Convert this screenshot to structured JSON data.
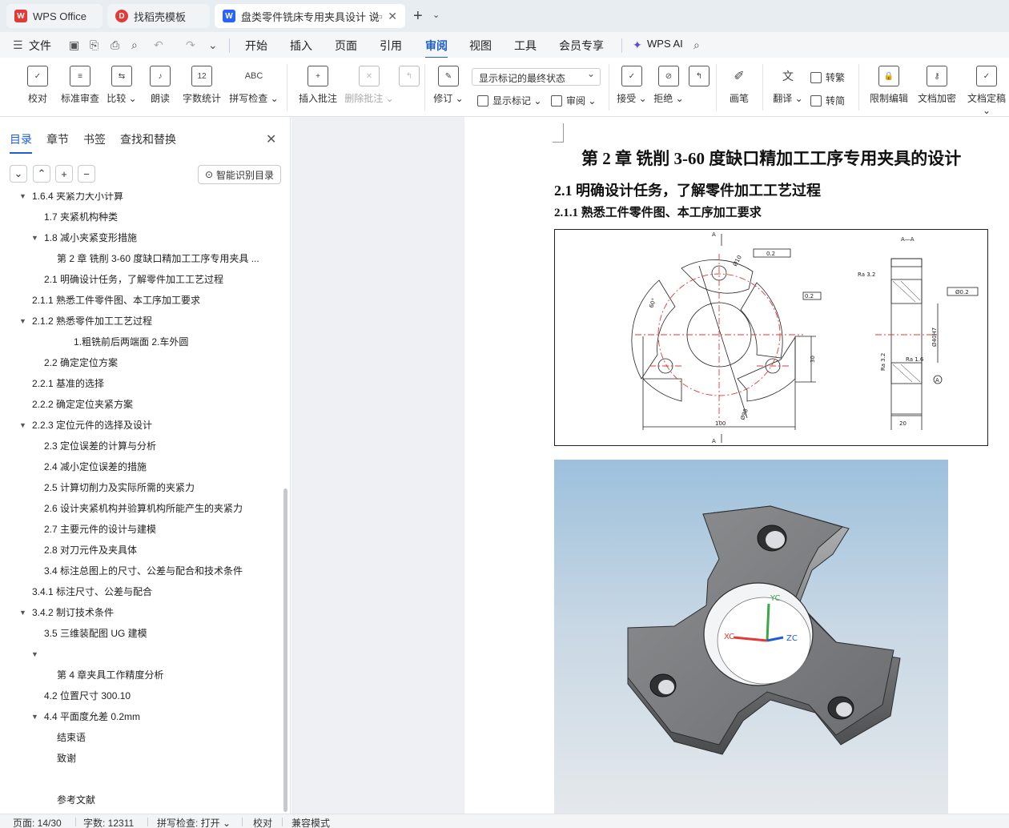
{
  "tabs": {
    "wps_office": "WPS Office",
    "template": "找稻壳模板",
    "document": "盘类零件铣床专用夹具设计 说"
  },
  "menu": {
    "file": "文件",
    "items": [
      "开始",
      "插入",
      "页面",
      "引用",
      "审阅",
      "视图",
      "工具",
      "会员专享"
    ],
    "active": "审阅",
    "wps_ai": "WPS AI"
  },
  "ribbon": {
    "proofread": "校对",
    "std_review": "标准审查",
    "compare": "比较",
    "read_aloud": "朗读",
    "word_count": "字数统计",
    "spell_check": "拼写检查",
    "insert_comment": "插入批注",
    "delete_comment": "删除批注",
    "track_changes": "修订",
    "markup_select": "显示标记的最终状态",
    "show_markup": "显示标记",
    "review": "审阅",
    "accept": "接受",
    "reject": "拒绝",
    "pen": "画笔",
    "translate": "翻译",
    "to_traditional": "转繁",
    "to_simplified": "转简",
    "restrict_edit": "限制编辑",
    "encrypt": "文档加密",
    "finalize": "文档定稿",
    "icon_word_count": "12",
    "icon_spell": "ABC"
  },
  "panel": {
    "tabs": [
      "目录",
      "章节",
      "书签",
      "查找和替换"
    ],
    "active_tab": "目录",
    "smart_toc": "智能识别目录",
    "toc": [
      {
        "text": "1.6.4  夹紧力大小计算",
        "indent": 1,
        "arrow": true
      },
      {
        "text": "1.7  夹紧机构种类",
        "indent": 2,
        "arrow": false
      },
      {
        "text": "1.8  减小夹紧变形措施",
        "indent": 2,
        "arrow": true
      },
      {
        "text": "第 2 章    铣削 3-60 度缺口精加工工序专用夹具 ...",
        "indent": 3,
        "arrow": false
      },
      {
        "text": "2.1  明确设计任务，了解零件加工工艺过程",
        "indent": 2,
        "arrow": false
      },
      {
        "text": "2.1.1  熟悉工件零件图、本工序加工要求",
        "indent": 1,
        "arrow": false
      },
      {
        "text": "2.1.2  熟悉零件加工工艺过程",
        "indent": 1,
        "arrow": true
      },
      {
        "text": "1.粗铣前后两端面            2.车外圆",
        "indent": 5,
        "arrow": false
      },
      {
        "text": "2.2  确定定位方案",
        "indent": 2,
        "arrow": false
      },
      {
        "text": "2.2.1  基准的选择",
        "indent": 1,
        "arrow": false
      },
      {
        "text": "2.2.2    确定定位夹紧方案",
        "indent": 1,
        "arrow": false
      },
      {
        "text": "2.2.3  定位元件的选择及设计",
        "indent": 1,
        "arrow": true
      },
      {
        "text": "2.3  定位误差的计算与分析",
        "indent": 2,
        "arrow": false
      },
      {
        "text": "2.4  减小定位误差的措施",
        "indent": 2,
        "arrow": false
      },
      {
        "text": "2.5  计算切削力及实际所需的夹紧力",
        "indent": 2,
        "arrow": false
      },
      {
        "text": "2.6  设计夹紧机构并验算机构所能产生的夹紧力",
        "indent": 2,
        "arrow": false
      },
      {
        "text": "2.7  主要元件的设计与建模",
        "indent": 2,
        "arrow": false
      },
      {
        "text": "2.8  对刀元件及夹具体",
        "indent": 2,
        "arrow": false
      },
      {
        "text": "3.4  标注总图上的尺寸、公差与配合和技术条件",
        "indent": 2,
        "arrow": false
      },
      {
        "text": "3.4.1  标注尺寸、公差与配合",
        "indent": 1,
        "arrow": false
      },
      {
        "text": "3.4.2 制订技术条件",
        "indent": 1,
        "arrow": true
      },
      {
        "text": "3.5  三维装配图 UG 建模",
        "indent": 2,
        "arrow": false
      },
      {
        "text": "",
        "indent": 2,
        "arrow": true
      },
      {
        "text": "第 4 章夹具工作精度分析",
        "indent": 3,
        "arrow": false
      },
      {
        "text": "4.2  位置尺寸 300.10",
        "indent": 2,
        "arrow": false
      },
      {
        "text": "4.4 平面度允差 0.2mm",
        "indent": 2,
        "arrow": true
      },
      {
        "text": "结束语",
        "indent": 3,
        "arrow": false
      },
      {
        "text": "致谢",
        "indent": 3,
        "arrow": false
      },
      {
        "text": "",
        "indent": 3,
        "arrow": false
      },
      {
        "text": "参考文献",
        "indent": 3,
        "arrow": false
      }
    ]
  },
  "document": {
    "chapter_title": "第 2 章    铣削 3-60 度缺口精加工工序专用夹具的设计",
    "heading_2_1": "2.1  明确设计任务，了解零件加工工艺过程",
    "heading_2_1_1": "2.1.1  熟悉工件零件图、本工序加工要求",
    "drawing_labels": {
      "section": "A—A",
      "a_top": "A",
      "a_bottom": "A",
      "tol1": "0.2",
      "tol2": "0.2",
      "tol3": "Ø0.2",
      "ra32_top": "Ra 3.2",
      "ra32_left": "Ra 3.2",
      "ra16": "Ra 1.6",
      "dim100": "100",
      "dim30": "30",
      "dim20": "20",
      "dim_bore": "Ø40H7",
      "angle": "60°",
      "dia_small": "Ø10",
      "dia_big": "Ø98",
      "datum": "A"
    },
    "axes": {
      "yc": "YC",
      "xc": "XC",
      "zc": "ZC"
    }
  },
  "status": {
    "page": "页面: 14/30",
    "words": "字数: 12311",
    "spell": "拼写检查: 打开",
    "proof": "校对",
    "compat": "兼容模式"
  }
}
